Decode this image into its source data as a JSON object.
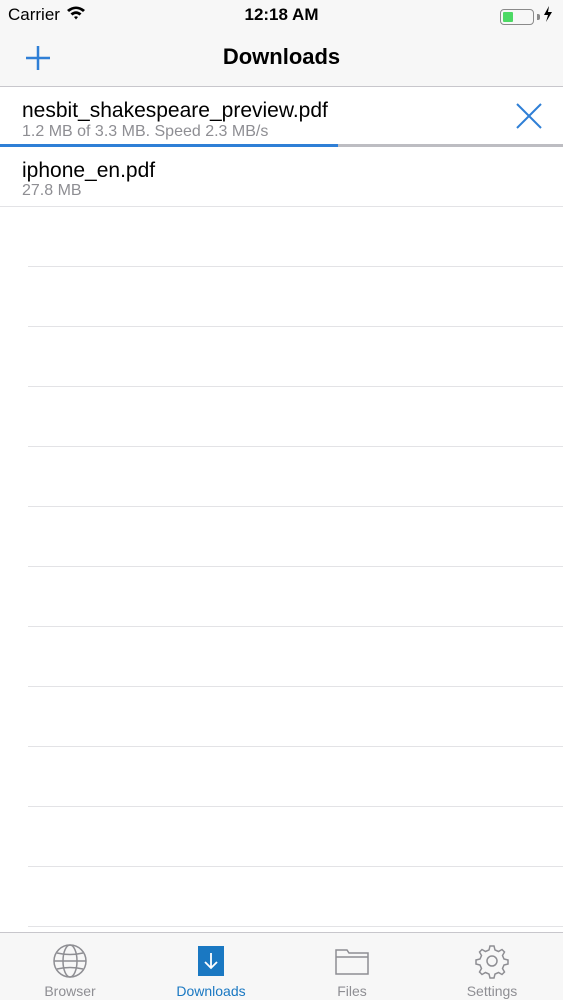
{
  "status_bar": {
    "carrier": "Carrier",
    "time": "12:18 AM",
    "battery_color": "#4cd964"
  },
  "nav": {
    "title": "Downloads",
    "add_icon": "plus-icon",
    "accent": "#2f7fd6"
  },
  "downloads": [
    {
      "name": "nesbit_shakespeare_preview.pdf",
      "detail": "1.2 MB of 3.3 MB. Speed 2.3 MB/s",
      "progress": 0.6,
      "in_progress": true
    },
    {
      "name": "iphone_en.pdf",
      "detail": "27.8 MB",
      "in_progress": false
    }
  ],
  "tabs": [
    {
      "label": "Browser",
      "icon": "globe-icon",
      "active": false
    },
    {
      "label": "Downloads",
      "icon": "download-icon",
      "active": true
    },
    {
      "label": "Files",
      "icon": "folder-icon",
      "active": false
    },
    {
      "label": "Settings",
      "icon": "gear-icon",
      "active": false
    }
  ]
}
